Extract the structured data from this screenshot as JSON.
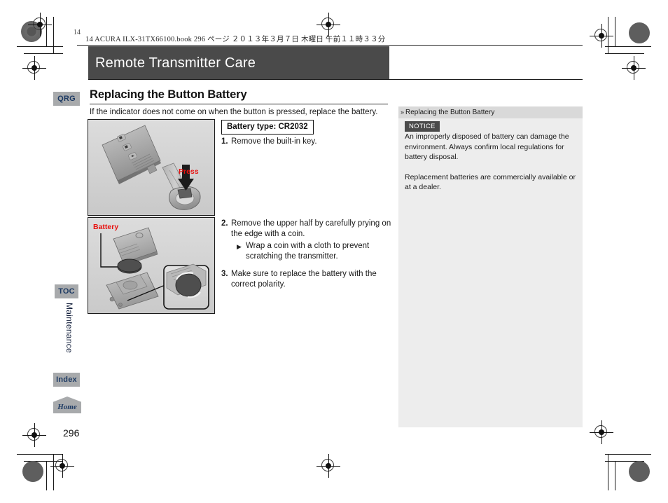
{
  "print_meta": {
    "text": "14 ACURA ILX-31TX66100.book   296 ページ   ２０１３年３月７日   木曜日   午前１１時３３分",
    "colorbar_label": "14"
  },
  "header": {
    "title": "Remote Transmitter Care"
  },
  "nav": {
    "qrg": "QRG",
    "toc": "TOC",
    "chapter": "Maintenance",
    "index": "Index",
    "home": "Home"
  },
  "main": {
    "heading": "Replacing the Button Battery",
    "intro": "If the indicator does not come on when the button is pressed, replace the battery.",
    "battery_type": "Battery type: CR2032",
    "steps": [
      {
        "num": "1.",
        "text": "Remove the built-in key.",
        "substeps": []
      },
      {
        "num": "2.",
        "text": "Remove the upper half by carefully prying on the edge with a coin.",
        "substeps": [
          "Wrap a coin with a cloth to prevent scratching the transmitter."
        ]
      },
      {
        "num": "3.",
        "text": "Make sure to replace the battery with the correct polarity.",
        "substeps": []
      }
    ]
  },
  "figures": {
    "fig1_label": "Press",
    "fig2_label": "Battery"
  },
  "info_panel": {
    "title": "Replacing the Button Battery",
    "badge": "NOTICE",
    "paragraphs": [
      "An improperly disposed of battery can damage the environment. Always confirm local regulations for battery disposal.",
      "Replacement batteries are commercially available or at a dealer."
    ]
  },
  "footer": {
    "page_number": "296"
  },
  "colors": {
    "header_bar": "#4a4a4a",
    "tab": "#a8aaac",
    "tab_text": "#1d3a63",
    "figure_bg": "#d2d2d2",
    "label_red": "#e8110f",
    "panel_bg": "#ededed",
    "panel_head": "#d9d9d9"
  }
}
